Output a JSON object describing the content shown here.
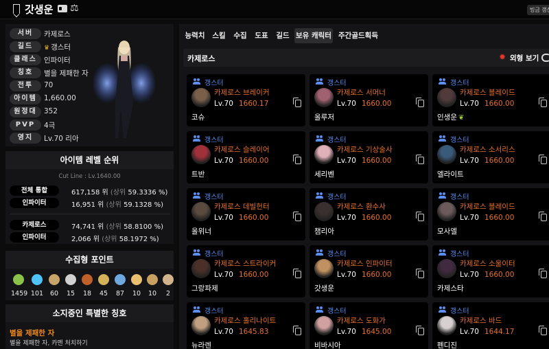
{
  "header": {
    "title": "갓생운",
    "update_label": "빙금 갱신"
  },
  "profile": {
    "rows": [
      {
        "label": "서버",
        "value": "카제로스"
      },
      {
        "label": "길드",
        "value": "갱스터"
      },
      {
        "label": "클래스",
        "value": "인파이터"
      },
      {
        "label": "칭호",
        "value": "별을 제패한 자"
      },
      {
        "label": "전투",
        "value": "70"
      },
      {
        "label": "아이템",
        "value": "1,660.00"
      },
      {
        "label": "원정대",
        "value": "352"
      },
      {
        "label": "PVP",
        "value": "4극"
      },
      {
        "label": "영지",
        "value": "Lv.70 리아"
      }
    ]
  },
  "ranking": {
    "title": "아이템 레벨 순위",
    "cutline": "Cut Line : Lv.1640.00",
    "rows": [
      {
        "label": "전체 통합",
        "rank": "617,158 위",
        "pct_prefix": "(상위",
        "pct": "59.3336 %)"
      },
      {
        "label": "인파이터",
        "rank": "16,951 위",
        "pct_prefix": "(상위",
        "pct": "59.1328 %)"
      },
      {
        "label": "카제로스",
        "rank": "74,741 위",
        "pct_prefix": "(상위",
        "pct": "58.8100 %)"
      },
      {
        "label": "인파이터",
        "rank": "2,066 위",
        "pct_prefix": "(상위",
        "pct": "58.1972 %)"
      }
    ]
  },
  "collection": {
    "title": "수집형 포인트",
    "items": [
      {
        "icon": "mokoko-seed-icon",
        "value": "1459",
        "color": "#8bc34a"
      },
      {
        "icon": "island-heart-icon",
        "value": "101",
        "color": "#4fc3f7"
      },
      {
        "icon": "art-icon",
        "value": "60",
        "color": "#c8a46a"
      },
      {
        "icon": "giant-heart-icon",
        "value": "15",
        "color": "#d0d0d0"
      },
      {
        "icon": "ignea-icon",
        "value": "18",
        "color": "#c0602a"
      },
      {
        "icon": "adventure-icon",
        "value": "45",
        "color": "#d4b25a"
      },
      {
        "icon": "sea-bounty-icon",
        "value": "87",
        "color": "#6fa8dc"
      },
      {
        "icon": "world-tree-icon",
        "value": "10",
        "color": "#e8c070"
      },
      {
        "icon": "orpheus-star-icon",
        "value": "10",
        "color": "#c8a060"
      },
      {
        "icon": "omnium-icon",
        "value": "2",
        "color": "#d2b48c"
      }
    ]
  },
  "special_title": {
    "title": "소지중인 특별한 칭호",
    "name": "별을 제패한 자",
    "desc": "별을 제패한 자, 카멘 처치하기"
  },
  "tabs": [
    {
      "label": "능력치",
      "active": false
    },
    {
      "label": "스킬",
      "active": false
    },
    {
      "label": "수집",
      "active": false
    },
    {
      "label": "도표",
      "active": false
    },
    {
      "label": "길드",
      "active": false
    },
    {
      "label": "보유 캐릭터",
      "active": true
    },
    {
      "label": "주간골드획득",
      "active": false
    }
  ],
  "characters_section": {
    "server": "카제로스",
    "toggle_label": "외형 보기",
    "cards": [
      {
        "guild": "갱스터",
        "server": "카제로스",
        "cls": "브레이커",
        "lv": "Lv.70",
        "il": "1660.17",
        "name": "코슈",
        "leaf": false,
        "avatar": "#7a5f4a"
      },
      {
        "guild": "갱스터",
        "server": "카제로스",
        "cls": "서머너",
        "lv": "Lv.70",
        "il": "1660.00",
        "name": "올루저",
        "leaf": false,
        "avatar": "#a06070"
      },
      {
        "guild": "갱스터",
        "server": "카제로스",
        "cls": "블레이드",
        "lv": "Lv.70",
        "il": "1660.00",
        "name": "인생운",
        "leaf": true,
        "avatar": "#503a3a"
      },
      {
        "guild": "갱스터",
        "server": "카제로스",
        "cls": "슬레이어",
        "lv": "Lv.70",
        "il": "1660.00",
        "name": "트반",
        "leaf": false,
        "avatar": "#a0303a"
      },
      {
        "guild": "갱스터",
        "server": "카제로스",
        "cls": "기상술사",
        "lv": "Lv.70",
        "il": "1660.00",
        "name": "세리벤",
        "leaf": false,
        "avatar": "#e0b0b8"
      },
      {
        "guild": "갱스터",
        "server": "카제로스",
        "cls": "소서리스",
        "lv": "Lv.70",
        "il": "1660.00",
        "name": "엘라이트",
        "leaf": false,
        "avatar": "#3a5a7a"
      },
      {
        "guild": "갱스터",
        "server": "카제로스",
        "cls": "데빌헌터",
        "lv": "Lv.70",
        "il": "1660.00",
        "name": "올위너",
        "leaf": false,
        "avatar": "#5a4a40"
      },
      {
        "guild": "갱스터",
        "server": "카제로스",
        "cls": "환수사",
        "lv": "Lv.70",
        "il": "1660.00",
        "name": "챔리아",
        "leaf": false,
        "avatar": "#3a3030"
      },
      {
        "guild": "갱스터",
        "server": "카제로스",
        "cls": "블레이드",
        "lv": "Lv.70",
        "il": "1660.00",
        "name": "모사엘",
        "leaf": false,
        "avatar": "#6a5a5a"
      },
      {
        "guild": "갱스터",
        "server": "카제로스",
        "cls": "스트라이커",
        "lv": "Lv.70",
        "il": "1660.00",
        "name": "그랑파제",
        "leaf": false,
        "avatar": "#4a3028"
      },
      {
        "guild": "갱스터",
        "server": "카제로스",
        "cls": "인파이터",
        "lv": "Lv.70",
        "il": "1660.00",
        "name": "갓생운",
        "leaf": false,
        "avatar": "#c09060"
      },
      {
        "guild": "갱스터",
        "server": "카제로스",
        "cls": "소울이터",
        "lv": "Lv.70",
        "il": "1660.00",
        "name": "카제스타",
        "leaf": false,
        "avatar": "#402a40"
      },
      {
        "guild": "갱스터",
        "server": "카제로스",
        "cls": "홀리나이트",
        "lv": "Lv.70",
        "il": "1645.83",
        "name": "뉴라렌",
        "leaf": false,
        "avatar": "#c0a080"
      },
      {
        "guild": "갱스터",
        "server": "카제로스",
        "cls": "도화가",
        "lv": "Lv.70",
        "il": "1645.00",
        "name": "비바시아",
        "leaf": false,
        "avatar": "#d0a0a0"
      },
      {
        "guild": "갱스터",
        "server": "카제로스",
        "cls": "바드",
        "lv": "Lv.70",
        "il": "1644.17",
        "name": "펜디진",
        "leaf": false,
        "avatar": "#d8d0d0"
      }
    ]
  }
}
